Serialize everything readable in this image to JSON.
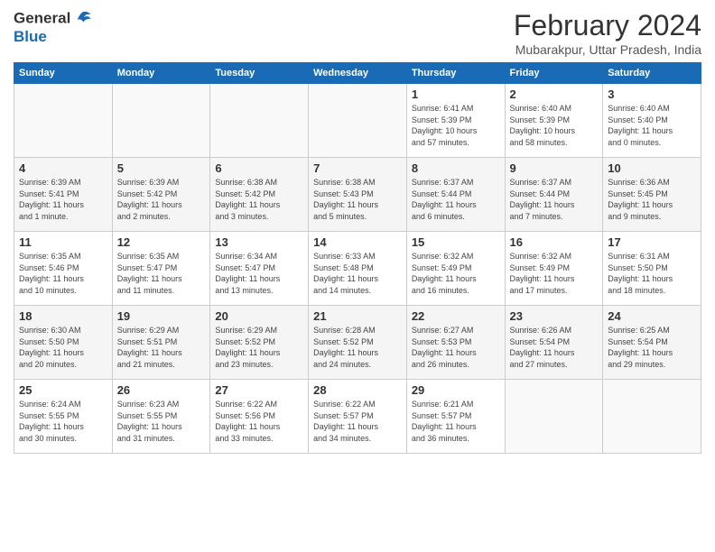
{
  "header": {
    "logo_general": "General",
    "logo_blue": "Blue",
    "month_title": "February 2024",
    "location": "Mubarakpur, Uttar Pradesh, India"
  },
  "weekdays": [
    "Sunday",
    "Monday",
    "Tuesday",
    "Wednesday",
    "Thursday",
    "Friday",
    "Saturday"
  ],
  "weeks": [
    [
      {
        "day": "",
        "info": ""
      },
      {
        "day": "",
        "info": ""
      },
      {
        "day": "",
        "info": ""
      },
      {
        "day": "",
        "info": ""
      },
      {
        "day": "1",
        "info": "Sunrise: 6:41 AM\nSunset: 5:39 PM\nDaylight: 10 hours\nand 57 minutes."
      },
      {
        "day": "2",
        "info": "Sunrise: 6:40 AM\nSunset: 5:39 PM\nDaylight: 10 hours\nand 58 minutes."
      },
      {
        "day": "3",
        "info": "Sunrise: 6:40 AM\nSunset: 5:40 PM\nDaylight: 11 hours\nand 0 minutes."
      }
    ],
    [
      {
        "day": "4",
        "info": "Sunrise: 6:39 AM\nSunset: 5:41 PM\nDaylight: 11 hours\nand 1 minute."
      },
      {
        "day": "5",
        "info": "Sunrise: 6:39 AM\nSunset: 5:42 PM\nDaylight: 11 hours\nand 2 minutes."
      },
      {
        "day": "6",
        "info": "Sunrise: 6:38 AM\nSunset: 5:42 PM\nDaylight: 11 hours\nand 3 minutes."
      },
      {
        "day": "7",
        "info": "Sunrise: 6:38 AM\nSunset: 5:43 PM\nDaylight: 11 hours\nand 5 minutes."
      },
      {
        "day": "8",
        "info": "Sunrise: 6:37 AM\nSunset: 5:44 PM\nDaylight: 11 hours\nand 6 minutes."
      },
      {
        "day": "9",
        "info": "Sunrise: 6:37 AM\nSunset: 5:44 PM\nDaylight: 11 hours\nand 7 minutes."
      },
      {
        "day": "10",
        "info": "Sunrise: 6:36 AM\nSunset: 5:45 PM\nDaylight: 11 hours\nand 9 minutes."
      }
    ],
    [
      {
        "day": "11",
        "info": "Sunrise: 6:35 AM\nSunset: 5:46 PM\nDaylight: 11 hours\nand 10 minutes."
      },
      {
        "day": "12",
        "info": "Sunrise: 6:35 AM\nSunset: 5:47 PM\nDaylight: 11 hours\nand 11 minutes."
      },
      {
        "day": "13",
        "info": "Sunrise: 6:34 AM\nSunset: 5:47 PM\nDaylight: 11 hours\nand 13 minutes."
      },
      {
        "day": "14",
        "info": "Sunrise: 6:33 AM\nSunset: 5:48 PM\nDaylight: 11 hours\nand 14 minutes."
      },
      {
        "day": "15",
        "info": "Sunrise: 6:32 AM\nSunset: 5:49 PM\nDaylight: 11 hours\nand 16 minutes."
      },
      {
        "day": "16",
        "info": "Sunrise: 6:32 AM\nSunset: 5:49 PM\nDaylight: 11 hours\nand 17 minutes."
      },
      {
        "day": "17",
        "info": "Sunrise: 6:31 AM\nSunset: 5:50 PM\nDaylight: 11 hours\nand 18 minutes."
      }
    ],
    [
      {
        "day": "18",
        "info": "Sunrise: 6:30 AM\nSunset: 5:50 PM\nDaylight: 11 hours\nand 20 minutes."
      },
      {
        "day": "19",
        "info": "Sunrise: 6:29 AM\nSunset: 5:51 PM\nDaylight: 11 hours\nand 21 minutes."
      },
      {
        "day": "20",
        "info": "Sunrise: 6:29 AM\nSunset: 5:52 PM\nDaylight: 11 hours\nand 23 minutes."
      },
      {
        "day": "21",
        "info": "Sunrise: 6:28 AM\nSunset: 5:52 PM\nDaylight: 11 hours\nand 24 minutes."
      },
      {
        "day": "22",
        "info": "Sunrise: 6:27 AM\nSunset: 5:53 PM\nDaylight: 11 hours\nand 26 minutes."
      },
      {
        "day": "23",
        "info": "Sunrise: 6:26 AM\nSunset: 5:54 PM\nDaylight: 11 hours\nand 27 minutes."
      },
      {
        "day": "24",
        "info": "Sunrise: 6:25 AM\nSunset: 5:54 PM\nDaylight: 11 hours\nand 29 minutes."
      }
    ],
    [
      {
        "day": "25",
        "info": "Sunrise: 6:24 AM\nSunset: 5:55 PM\nDaylight: 11 hours\nand 30 minutes."
      },
      {
        "day": "26",
        "info": "Sunrise: 6:23 AM\nSunset: 5:55 PM\nDaylight: 11 hours\nand 31 minutes."
      },
      {
        "day": "27",
        "info": "Sunrise: 6:22 AM\nSunset: 5:56 PM\nDaylight: 11 hours\nand 33 minutes."
      },
      {
        "day": "28",
        "info": "Sunrise: 6:22 AM\nSunset: 5:57 PM\nDaylight: 11 hours\nand 34 minutes."
      },
      {
        "day": "29",
        "info": "Sunrise: 6:21 AM\nSunset: 5:57 PM\nDaylight: 11 hours\nand 36 minutes."
      },
      {
        "day": "",
        "info": ""
      },
      {
        "day": "",
        "info": ""
      }
    ]
  ]
}
